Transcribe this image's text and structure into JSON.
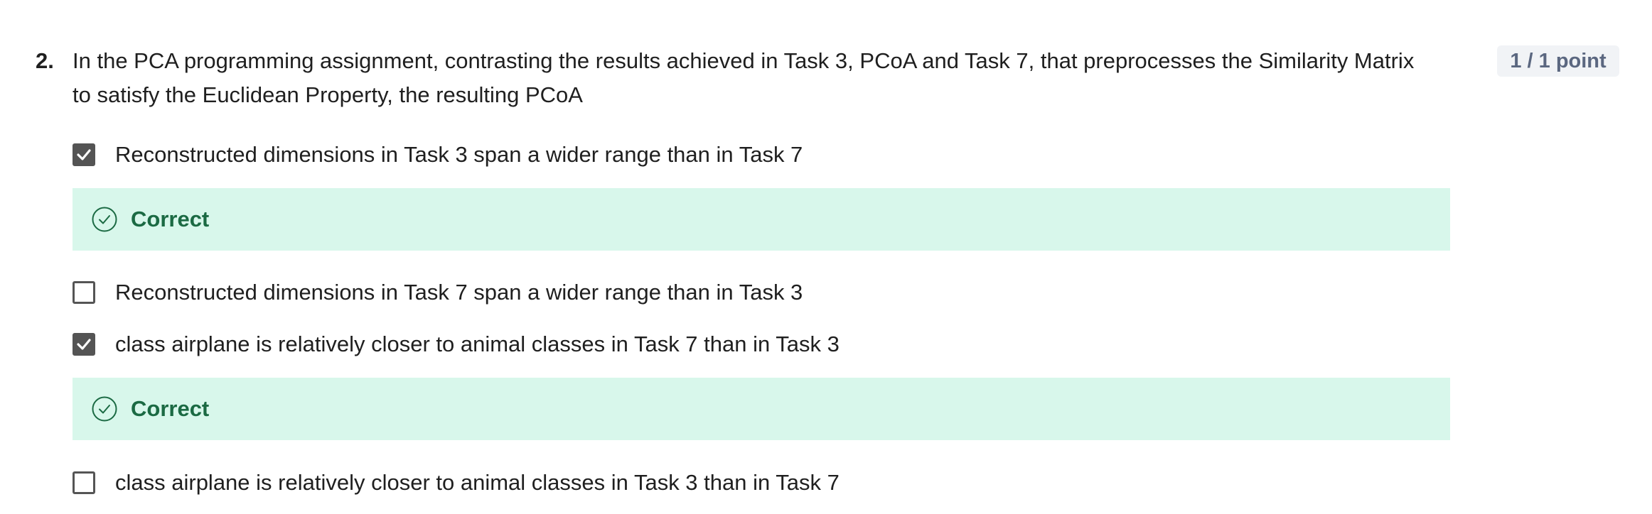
{
  "question": {
    "number": "2.",
    "text": "In the PCA programming assignment, contrasting the results achieved in Task 3, PCoA and Task 7, that preprocesses the Similarity Matrix to satisfy the Euclidean Property, the resulting PCoA",
    "points": "1 / 1 point"
  },
  "options": [
    {
      "label": "Reconstructed dimensions in Task 3 span a wider range than in Task 7",
      "checked": true
    },
    {
      "label": "Reconstructed dimensions in Task 7 span a wider range than in Task 3",
      "checked": false
    },
    {
      "label": "class airplane is relatively closer to animal classes in Task 7 than in Task 3",
      "checked": true
    },
    {
      "label": "class airplane is relatively closer to animal classes in Task 3 than in Task 7",
      "checked": false
    }
  ],
  "feedback": [
    {
      "label": "Correct"
    },
    {
      "label": "Correct"
    }
  ],
  "colors": {
    "correct_bg": "#d8f7eb",
    "correct_text": "#1b6a43",
    "checkbox_checked": "#545454",
    "badge_bg": "#f1f3f6",
    "badge_text": "#5b6780"
  },
  "icons": {
    "checked_box": "check-icon",
    "feedback": "check-circle-icon"
  }
}
